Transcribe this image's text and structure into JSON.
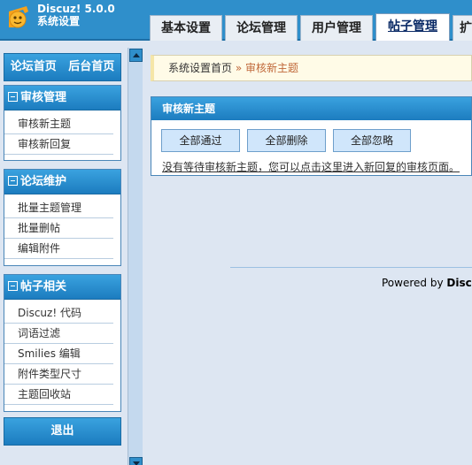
{
  "app": {
    "title": "Discuz! 5.0.0",
    "subtitle": "系统设置"
  },
  "tabs": [
    {
      "label": "基本设置"
    },
    {
      "label": "论坛管理"
    },
    {
      "label": "用户管理"
    },
    {
      "label": "帖子管理",
      "active": true
    },
    {
      "label": "扩"
    }
  ],
  "sidebar": {
    "top_links": {
      "home": "论坛首页",
      "admin": "后台首页"
    },
    "sections": [
      {
        "title": "审核管理",
        "items": [
          "审核新主题",
          "审核新回复"
        ]
      },
      {
        "title": "论坛维护",
        "items": [
          "批量主题管理",
          "批量删帖",
          "编辑附件"
        ]
      },
      {
        "title": "帖子相关",
        "items": [
          "Discuz! 代码",
          "词语过滤",
          "Smilies 编辑",
          "附件类型尺寸",
          "主题回收站"
        ]
      }
    ],
    "logout": "退出"
  },
  "breadcrumb": {
    "home": "系统设置首页",
    "separator": "»",
    "current": "审核新主题"
  },
  "panel": {
    "title": "审核新主题",
    "buttons": {
      "approve_all": "全部通过",
      "delete_all": "全部删除",
      "ignore_all": "全部忽略"
    },
    "notice": "没有等待审核新主题，您可以点击这里进入新回复的审核页面。"
  },
  "footer": {
    "powered_prefix": "Powered by",
    "powered_brand": "Discuz"
  },
  "colors": {
    "header_bg": "#2f8fcb",
    "accent": "#c0683a",
    "block_head": "#1c7cbf"
  }
}
